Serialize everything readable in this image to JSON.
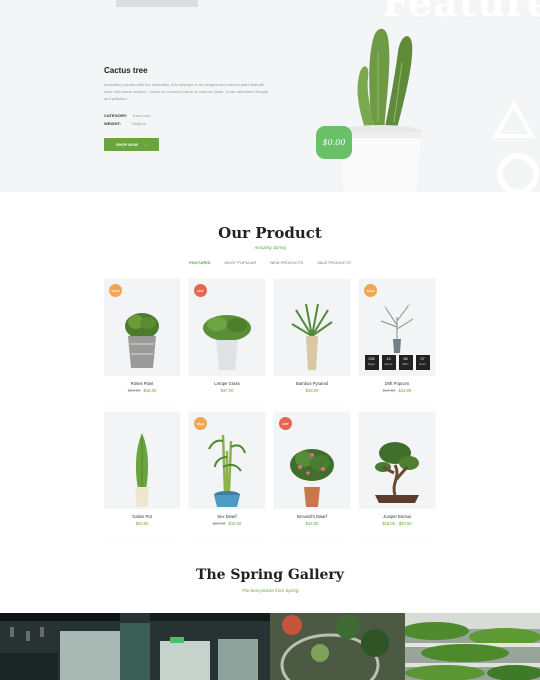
{
  "hero": {
    "bg_word": "Featured",
    "title": "Cactus tree",
    "description": "Incredibly popular with the Victorians, this epiphyte is an elegant and tolerant plant that will cope with some neglect - hence its common name of cast iron plant. It can withstand drought and pollution.",
    "category_label": "CATEGORY:",
    "category_value": "Trees Ices",
    "weight_label": "WEIGHT:",
    "weight_value": "Regium",
    "button_label": "SHOP NOW",
    "price": "$0.00"
  },
  "products_section": {
    "title": "Our Product",
    "subtitle": "Amazing Spring",
    "filters": [
      "FEATURED",
      "MOST POPULAR",
      "NEW PRODUCTS",
      "SALE PRODUCTS"
    ],
    "products": [
      {
        "name": "Roses Plant",
        "old_price": "$20.00",
        "price": "$16.00",
        "badge": "sale",
        "badge_text": "SALE"
      },
      {
        "name": "Lirrope Grass",
        "old_price": "",
        "price": "$37.00",
        "badge": "hot",
        "badge_text": "HOT"
      },
      {
        "name": "Bambus Pyramid",
        "old_price": "",
        "price": "$18.00",
        "badge": "",
        "badge_text": ""
      },
      {
        "name": "Drift Popcorn",
        "old_price": "$16.00",
        "price": "$14.00",
        "badge": "sale",
        "badge_text": "SALE"
      },
      {
        "name": "Galion Pot",
        "old_price": "",
        "price": "$20.00",
        "badge": "",
        "badge_text": ""
      },
      {
        "name": "Sex Dwarf",
        "old_price": "$20.00",
        "price": "$18.00",
        "badge": "sale",
        "badge_text": "SALE"
      },
      {
        "name": "Broussil's Dwarf",
        "old_price": "",
        "price": "$18.00",
        "badge": "hot",
        "badge_text": "HOT"
      },
      {
        "name": "Juniper Bonsai",
        "old_price": "",
        "price": "$18.00 - $20.00",
        "badge": "",
        "badge_text": ""
      }
    ],
    "countdown": [
      {
        "value": "239",
        "unit": "Days"
      },
      {
        "value": "13",
        "unit": "Hours"
      },
      {
        "value": "58",
        "unit": "Mins"
      },
      {
        "value": "07",
        "unit": "Secs"
      }
    ]
  },
  "gallery_section": {
    "title": "The Spring Gallery",
    "subtitle": "The best picture from Spring"
  },
  "colors": {
    "accent": "#6aa43d",
    "sale_badge": "#f2a654",
    "hot_badge": "#e4684f",
    "price_bubble": "#69c069"
  }
}
